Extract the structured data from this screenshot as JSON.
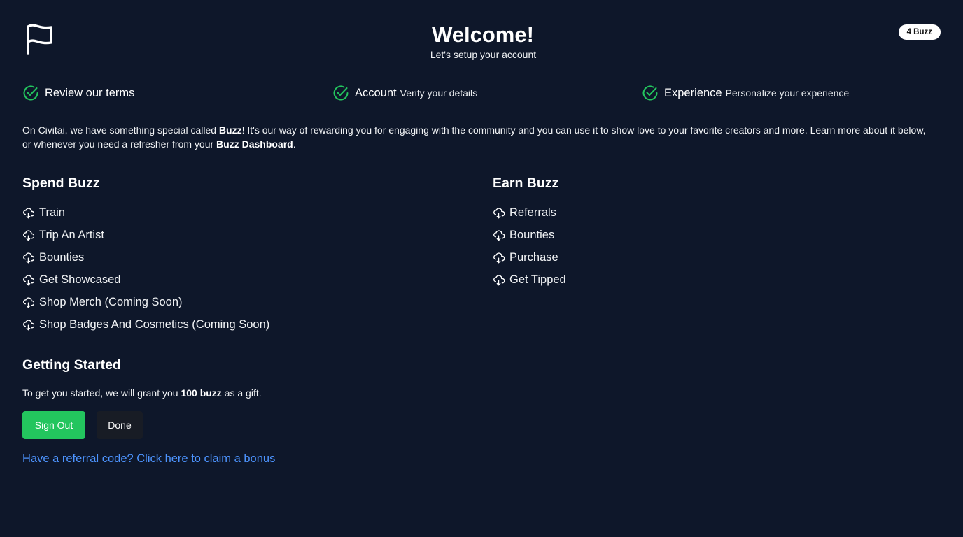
{
  "header": {
    "title": "Welcome!",
    "subtitle": "Let's setup your account",
    "buzz_badge": "4 Buzz"
  },
  "steps": [
    {
      "label": "Review our terms",
      "description": ""
    },
    {
      "label": "Account",
      "description": "Verify your details"
    },
    {
      "label": "Experience",
      "description": "Personalize your experience"
    }
  ],
  "intro": {
    "part1": "On Civitai, we have something special called ",
    "buzz": "Buzz",
    "part2": "! It's our way of rewarding you for engaging with the community and you can use it to show love to your favorite creators and more. Learn more about it below, or whenever you need a refresher from your ",
    "dashboard": "Buzz Dashboard",
    "part3": "."
  },
  "spend": {
    "title": "Spend Buzz",
    "items": [
      "Train",
      "Trip An Artist",
      "Bounties",
      "Get Showcased",
      "Shop Merch (Coming Soon)",
      "Shop Badges And Cosmetics (Coming Soon)"
    ]
  },
  "earn": {
    "title": "Earn Buzz",
    "items": [
      "Referrals",
      "Bounties",
      "Purchase",
      "Get Tipped"
    ]
  },
  "getting_started": {
    "title": "Getting Started",
    "text1": "To get you started, we will grant you ",
    "amount": "100 buzz",
    "text2": " as a gift."
  },
  "buttons": {
    "sign_out": "Sign Out",
    "done": "Done"
  },
  "referral_link": "Have a referral code? Click here to claim a bonus",
  "colors": {
    "background": "#0e172a",
    "accent_green": "#23c55e",
    "link_blue": "#4d94ff"
  },
  "icons": {
    "logo": "flag-icon",
    "step": "circle-check-icon",
    "list": "cloud-download-icon"
  }
}
